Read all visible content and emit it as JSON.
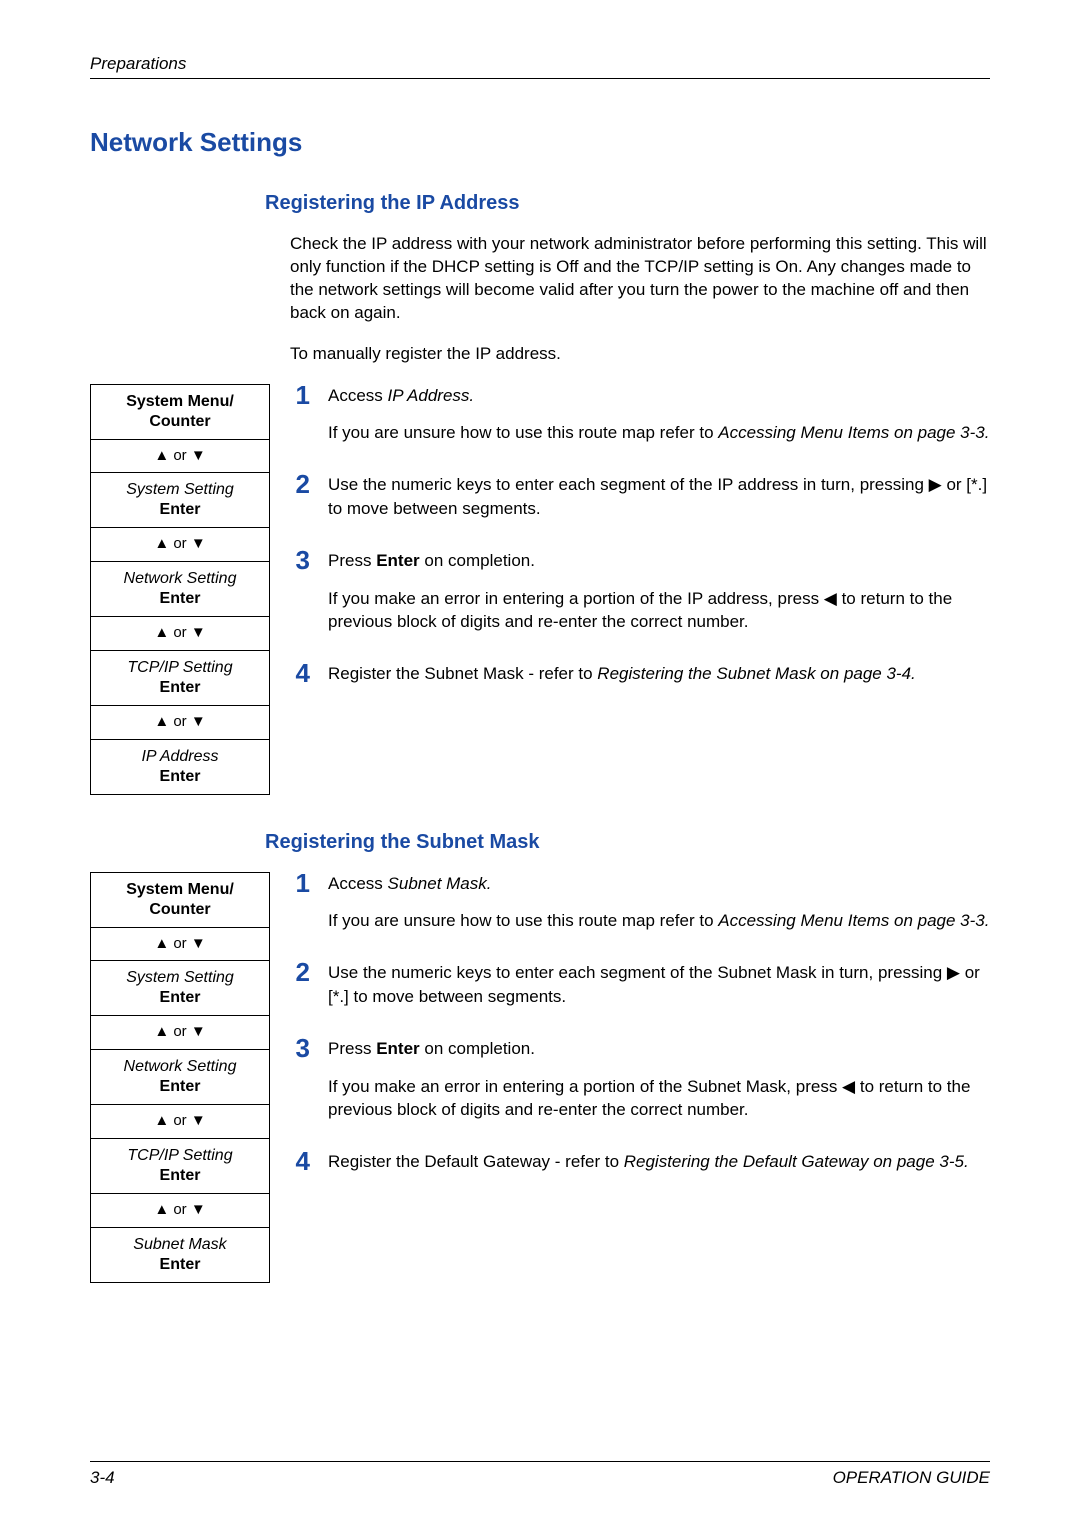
{
  "header": {
    "chapter": "Preparations"
  },
  "heading1": "Network Settings",
  "footer": {
    "pageNum": "3-4",
    "guide": "OPERATION GUIDE"
  },
  "nav": {
    "upOrDown": "▲ or ▼"
  },
  "routemap": {
    "title_l1": "System Menu/",
    "title_l2": "Counter",
    "systemSetting": "System Setting",
    "networkSetting": "Network Setting",
    "tcpip": "TCP/IP Setting",
    "ipAddress": "IP Address",
    "subnetMask": "Subnet Mask",
    "enter": "Enter"
  },
  "sections": {
    "ip": {
      "heading": "Registering the IP Address",
      "intro1": "Check the IP address with your network administrator before performing this setting. This will only function if the DHCP setting is Off and the TCP/IP setting is On. Any changes made to the network settings will become valid after you turn the power to the machine off and then back on again.",
      "intro2": "To manually register the IP address.",
      "step1a_pre": "Access ",
      "step1a_it": "IP Address.",
      "step1b_pre": "If you are unsure how to use this route map refer to ",
      "step1b_it": "Accessing Menu Items on page 3-3.",
      "step2": "Use the numeric keys to enter each segment of the IP address in turn, pressing ▶ or [*.] to move between segments.",
      "step3a_pre": "Press ",
      "step3a_bold": "Enter",
      "step3a_post": " on completion.",
      "step3b": "If you make an error in entering a portion of the IP address, press ◀ to return to the previous block of digits and re-enter the correct number.",
      "step4_pre": "Register the Subnet Mask - refer to ",
      "step4_it": "Registering the Subnet Mask on page 3-4."
    },
    "sm": {
      "heading": "Registering the Subnet Mask",
      "step1a_pre": "Access ",
      "step1a_it": "Subnet Mask.",
      "step1b_pre": "If you are unsure how to use this route map refer to ",
      "step1b_it": "Accessing Menu Items on page 3-3.",
      "step2": "Use the numeric keys to enter each segment of the Subnet Mask in turn, pressing ▶ or [*.] to move between segments.",
      "step3a_pre": "Press ",
      "step3a_bold": "Enter",
      "step3a_post": " on completion.",
      "step3b": "If you make an error in entering a portion of the Subnet Mask, press ◀ to return to the previous block of digits and re-enter the correct number.",
      "step4_pre": "Register the Default Gateway - refer to ",
      "step4_it": "Registering the Default Gateway on page 3-5."
    }
  },
  "nums": {
    "n1": "1",
    "n2": "2",
    "n3": "3",
    "n4": "4"
  }
}
